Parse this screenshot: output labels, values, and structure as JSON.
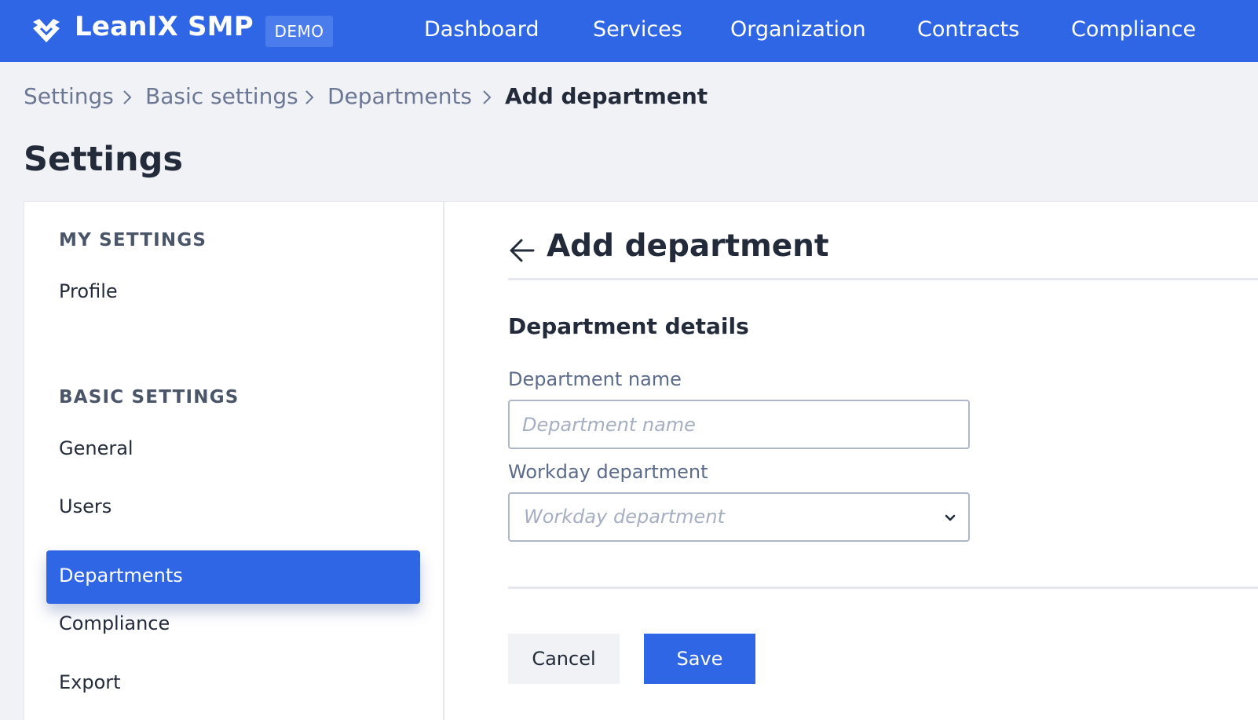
{
  "app": {
    "brand": "LeanIX SMP",
    "badge": "DEMO",
    "brand_color": "#2f66e5"
  },
  "nav": {
    "items": [
      "Dashboard",
      "Services",
      "Organization",
      "Contracts",
      "Compliance"
    ]
  },
  "breadcrumb": {
    "items": [
      "Settings",
      "Basic settings",
      "Departments"
    ],
    "current": "Add department",
    "separator_icon": "chevron-right-icon"
  },
  "page": {
    "title": "Settings"
  },
  "sidebar": {
    "sections": [
      {
        "heading": "MY SETTINGS",
        "items": [
          "Profile"
        ]
      },
      {
        "heading": "BASIC SETTINGS",
        "items": [
          "General",
          "Users",
          "Departments",
          "Compliance",
          "Export"
        ]
      }
    ],
    "active_item": "Departments"
  },
  "panel": {
    "title": "Add department",
    "back_icon": "arrow-left-icon",
    "section_title": "Department details",
    "fields": {
      "name": {
        "label": "Department name",
        "placeholder": "Department name",
        "value": ""
      },
      "workday": {
        "label": "Workday department",
        "placeholder": "Workday department",
        "value": "",
        "icon": "chevron-down-icon"
      }
    },
    "buttons": {
      "cancel": "Cancel",
      "save": "Save"
    }
  }
}
